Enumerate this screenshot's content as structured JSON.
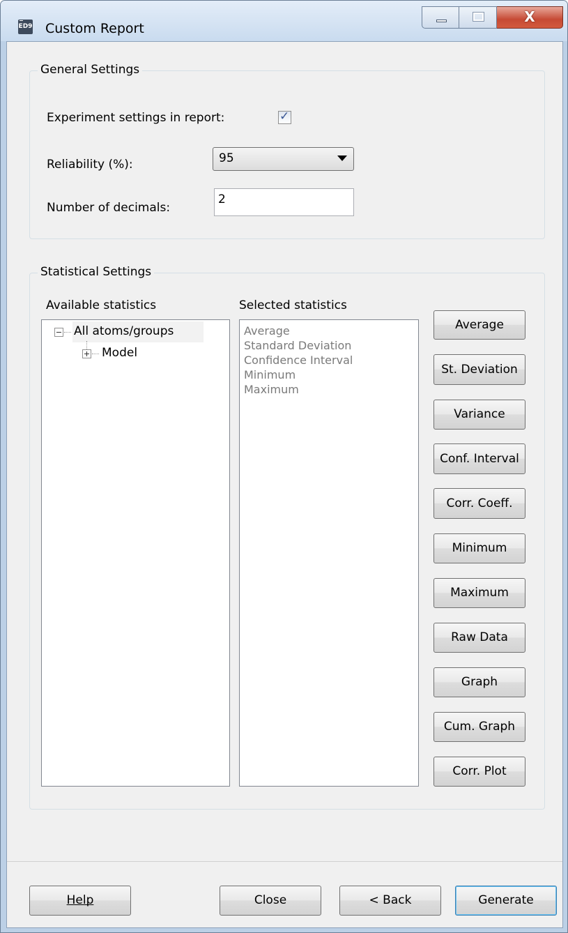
{
  "window": {
    "title": "Custom Report",
    "icon_text": "ED9"
  },
  "general": {
    "title": "General Settings",
    "experiment_label": "Experiment settings in report:",
    "experiment_checked": true,
    "reliability_label": "Reliability (%):",
    "reliability_value": "95",
    "decimals_label": "Number of decimals:",
    "decimals_value": "2"
  },
  "statistical": {
    "title": "Statistical Settings",
    "available_label": "Available statistics",
    "selected_label": "Selected statistics",
    "tree": {
      "root": "All atoms/groups",
      "child": "Model"
    },
    "selected_items": [
      "Average",
      "Standard Deviation",
      "Confidence Interval",
      "Minimum",
      "Maximum"
    ],
    "buttons": [
      "Average",
      "St. Deviation",
      "Variance",
      "Conf. Interval",
      "Corr. Coeff.",
      "Minimum",
      "Maximum",
      "Raw Data",
      "Graph",
      "Cum. Graph",
      "Corr. Plot"
    ]
  },
  "footer": {
    "help": "Help",
    "close": "Close",
    "back": "< Back",
    "generate": "Generate"
  }
}
